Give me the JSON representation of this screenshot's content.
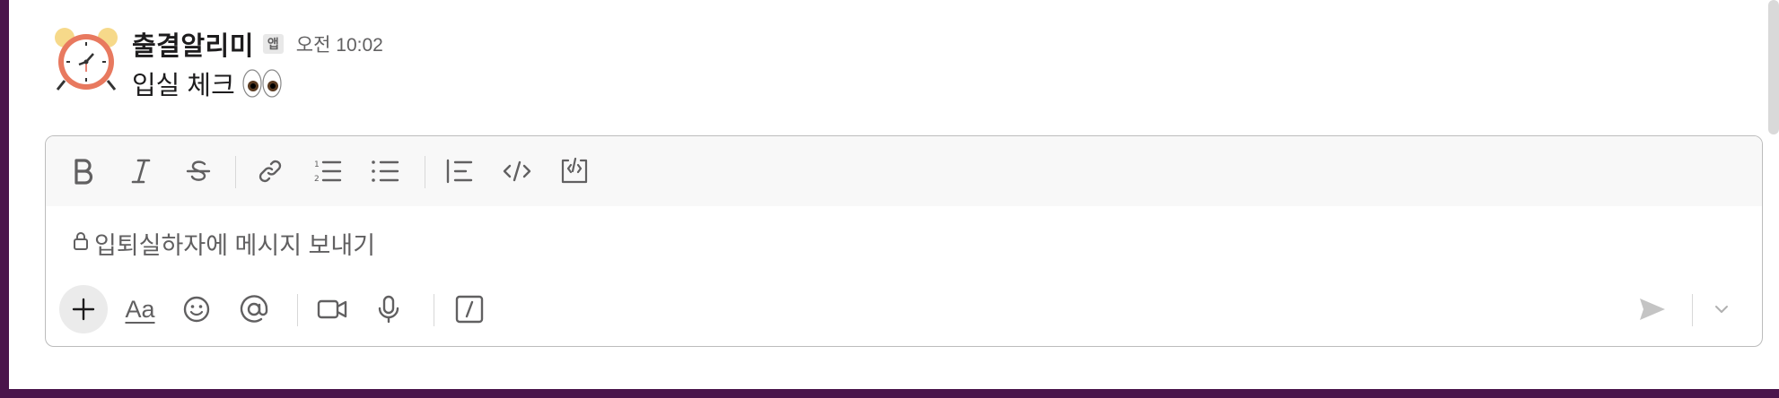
{
  "messages": [
    {
      "sender": "출결알리미",
      "badge": "앱",
      "time": "오전 10:02",
      "text": "입실 체크",
      "emoji": "eyes"
    }
  ],
  "composer": {
    "placeholder": "입퇴실하자에 메시지 보내기",
    "format_toolbar": [
      "bold-icon",
      "italic-icon",
      "strikethrough-icon",
      "link-icon",
      "ordered-list-icon",
      "bulleted-list-icon",
      "blockquote-icon",
      "code-icon",
      "code-block-icon"
    ],
    "action_toolbar": [
      "plus-icon",
      "text-format-icon",
      "emoji-icon",
      "mention-icon",
      "video-icon",
      "microphone-icon",
      "slash-command-icon"
    ],
    "text_format_label": "Aa"
  },
  "colors": {
    "sidebar": "#4a154b",
    "muted_text": "#616061",
    "icon": "#616061",
    "border": "#bcbcbc"
  }
}
